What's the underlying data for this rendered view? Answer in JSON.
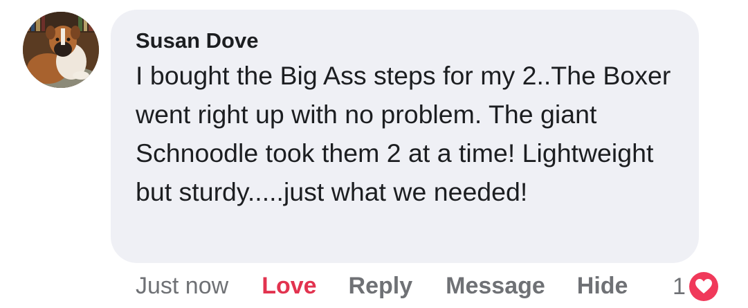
{
  "comment": {
    "author": "Susan Dove",
    "text": "I bought the Big Ass steps for my 2..The Boxer went right up with no problem. The giant Schnoodle took them 2 at a time! Lightweight but sturdy.....just what we needed!"
  },
  "actions": {
    "timestamp": "Just now",
    "love_label": "Love",
    "reply_label": "Reply",
    "message_label": "Message",
    "hide_label": "Hide"
  },
  "reactions": {
    "count": "1",
    "icon": "heart-icon",
    "color": "#f0395a"
  },
  "colors": {
    "bubble_background": "#eff0f5",
    "love_active": "#e2334f",
    "muted_text": "#6f7175",
    "primary_text": "#1c1e21"
  }
}
